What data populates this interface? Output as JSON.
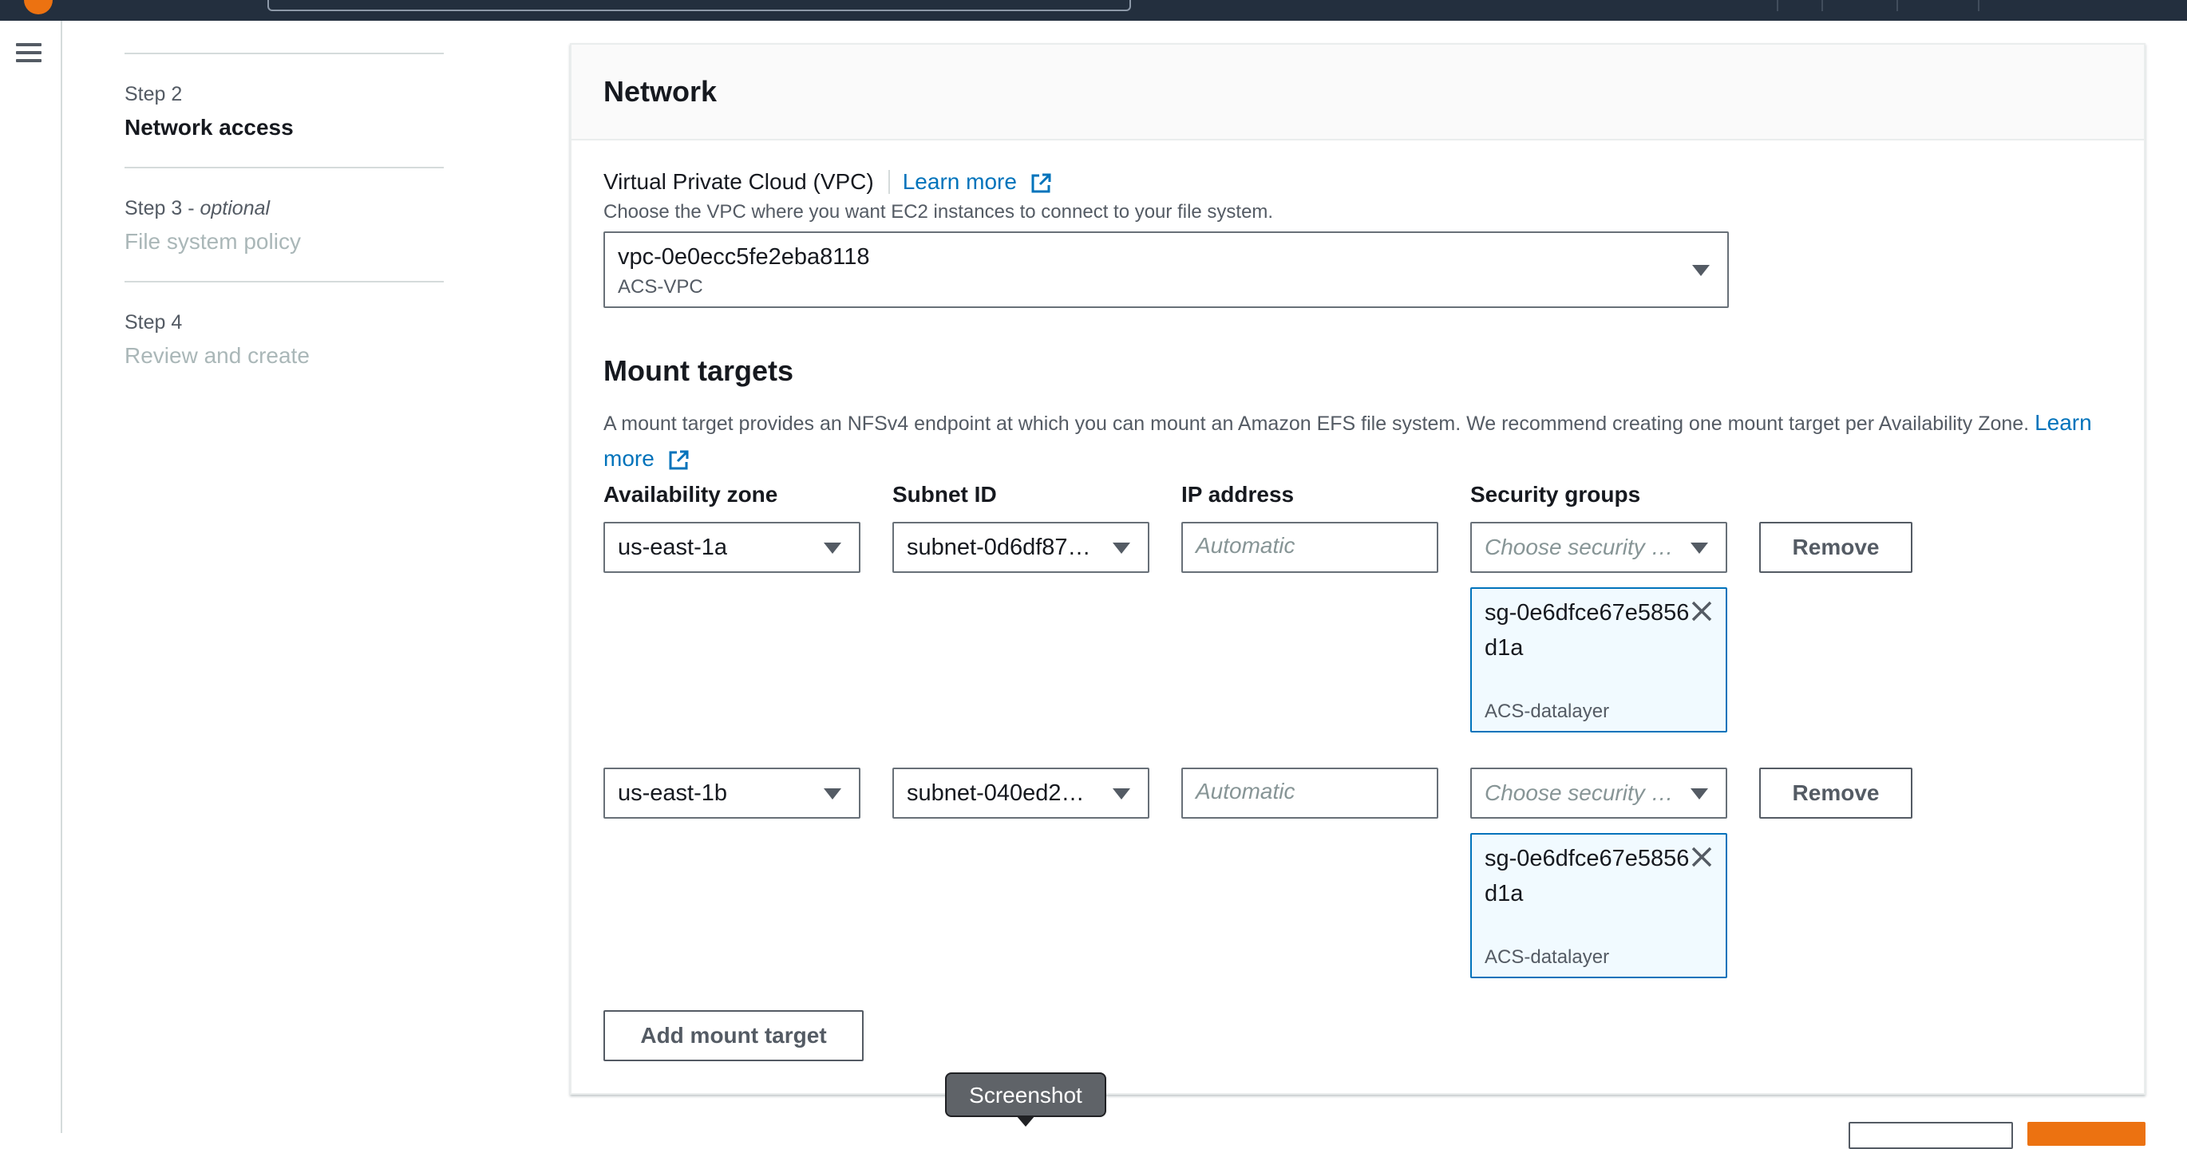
{
  "steps": [
    {
      "num": "Step 2",
      "suffix": "",
      "title": "Network access",
      "state": "active"
    },
    {
      "num": "Step 3 - ",
      "suffix": "optional",
      "title": "File system policy",
      "state": "inactive"
    },
    {
      "num": "Step 4",
      "suffix": "",
      "title": "Review and create",
      "state": "inactive"
    }
  ],
  "network": {
    "heading": "Network",
    "vpc_label": "Virtual Private Cloud (VPC)",
    "learn_more": "Learn more",
    "vpc_desc": "Choose the VPC where you want EC2 instances to connect to your file system.",
    "vpc_value": "vpc-0e0ecc5fe2eba8118",
    "vpc_name": "ACS-VPC"
  },
  "mount_targets": {
    "heading": "Mount targets",
    "desc": "A mount target provides an NFSv4 endpoint at which you can mount an Amazon EFS file system. We recommend creating one mount target per Availability Zone.",
    "learn_more_1": "Learn",
    "learn_more_2": "more",
    "columns": {
      "az": "Availability zone",
      "subnet": "Subnet ID",
      "ip": "IP address",
      "sg": "Security groups"
    },
    "ip_placeholder": "Automatic",
    "sg_placeholder": "Choose security …",
    "remove_label": "Remove",
    "rows": [
      {
        "az": "us-east-1a",
        "subnet": "subnet-0d6df87…",
        "sg_token": "sg-0e6dfce67e5856d1a",
        "sg_name": "ACS-datalayer"
      },
      {
        "az": "us-east-1b",
        "subnet": "subnet-040ed2…",
        "sg_token": "sg-0e6dfce67e5856d1a",
        "sg_name": "ACS-datalayer"
      }
    ],
    "add_label": "Add mount target"
  },
  "tooltip": "Screenshot",
  "colors": {
    "link": "#0073bb",
    "nav_dark": "#232f3e",
    "primary_orange": "#ec7211",
    "token_bg": "#f1faff"
  }
}
